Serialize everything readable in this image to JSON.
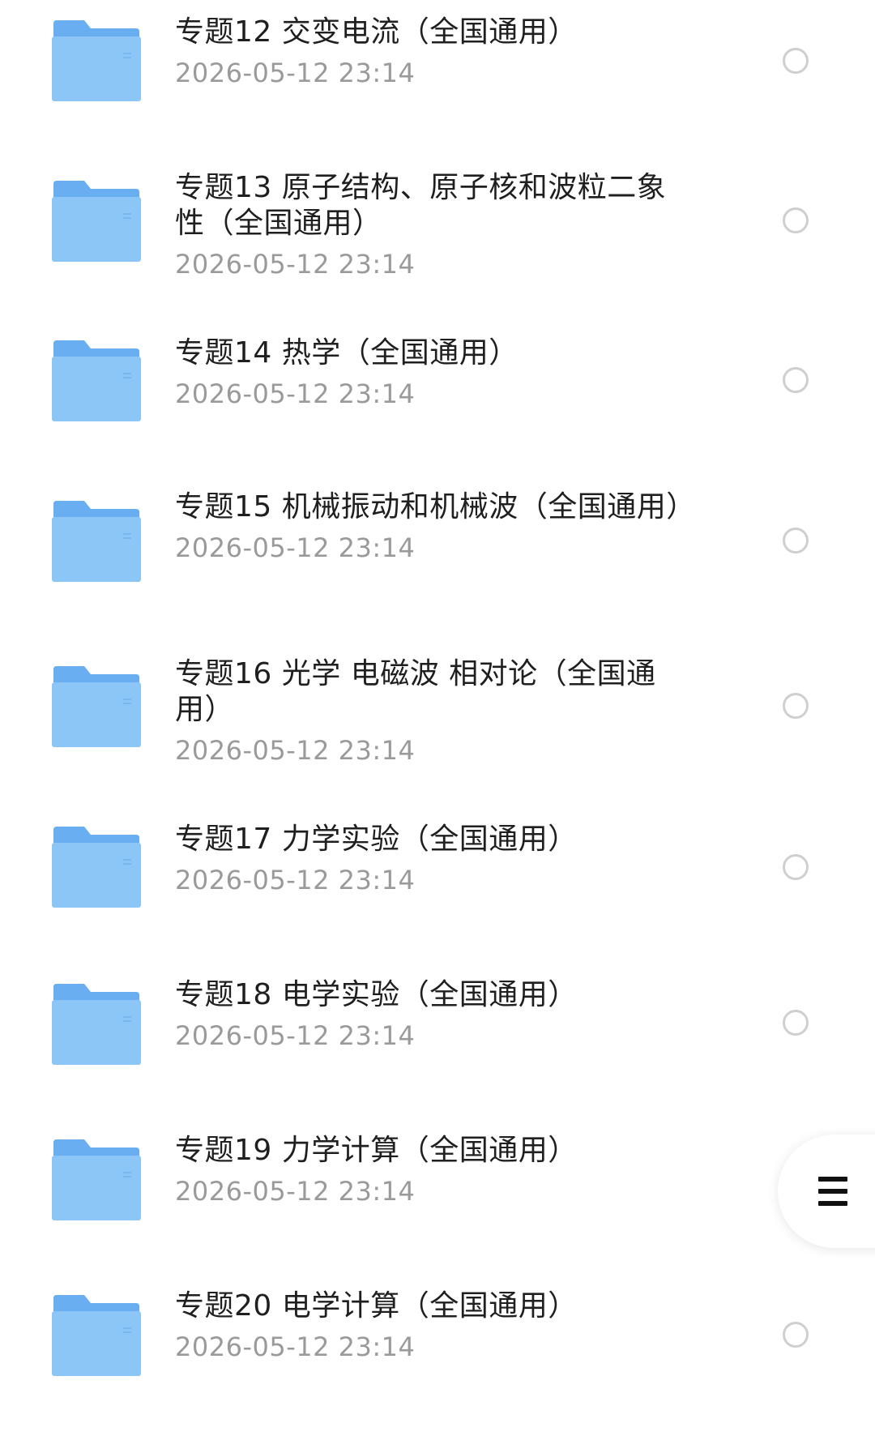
{
  "colors": {
    "folder_front": "#8cc6f6",
    "folder_back": "#68aef0",
    "title": "#1f1f1f",
    "date": "#9a9a9a",
    "radio_border": "#cfcfcf"
  },
  "files": [
    {
      "title": "专题12 交变电流（全国通用）",
      "date": "2026-05-12 23:14",
      "icon": "folder-icon"
    },
    {
      "title": "专题13 原子结构、原子核和波粒二象性（全国通用）",
      "date": "2026-05-12 23:14",
      "icon": "folder-icon"
    },
    {
      "title": "专题14 热学（全国通用）",
      "date": "2026-05-12 23:14",
      "icon": "folder-icon"
    },
    {
      "title": "专题15 机械振动和机械波（全国通用）",
      "date": "2026-05-12 23:14",
      "icon": "folder-icon"
    },
    {
      "title": "专题16 光学 电磁波 相对论（全国通用）",
      "date": "2026-05-12 23:14",
      "icon": "folder-icon"
    },
    {
      "title": "专题17 力学实验（全国通用）",
      "date": "2026-05-12 23:14",
      "icon": "folder-icon"
    },
    {
      "title": "专题18 电学实验（全国通用）",
      "date": "2026-05-12 23:14",
      "icon": "folder-icon"
    },
    {
      "title": "专题19 力学计算（全国通用）",
      "date": "2026-05-12 23:14",
      "icon": "folder-icon"
    },
    {
      "title": "专题20 电学计算（全国通用）",
      "date": "2026-05-12 23:14",
      "icon": "folder-icon"
    }
  ],
  "fab": {
    "icon": "menu-icon"
  }
}
